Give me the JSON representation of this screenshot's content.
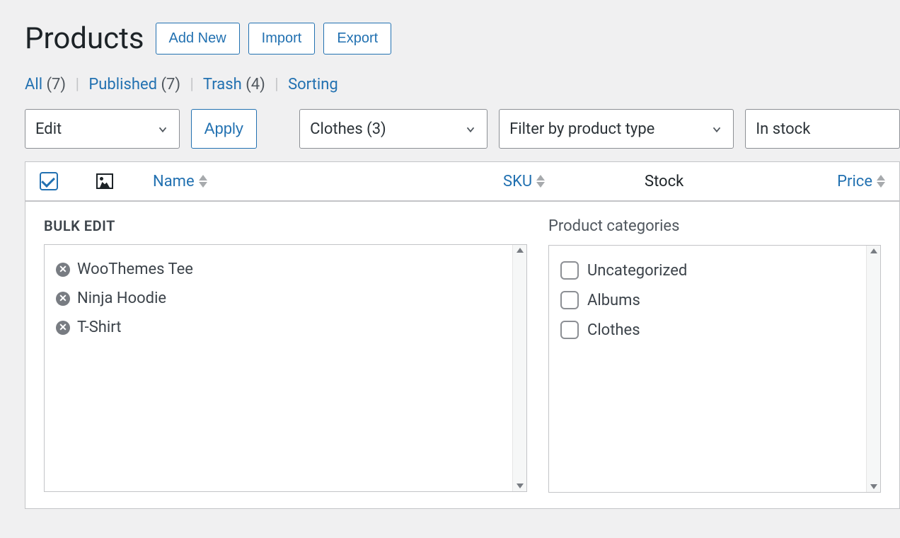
{
  "header": {
    "title": "Products",
    "buttons": {
      "add_new": "Add New",
      "import": "Import",
      "export": "Export"
    }
  },
  "status_links": {
    "all_label": "All",
    "all_count": "(7)",
    "published_label": "Published",
    "published_count": "(7)",
    "trash_label": "Trash",
    "trash_count": "(4)",
    "sorting_label": "Sorting"
  },
  "filters": {
    "bulk_action": "Edit",
    "apply_label": "Apply",
    "category": "Clothes  (3)",
    "type": "Filter by product type",
    "stock": "In stock"
  },
  "columns": {
    "name": "Name",
    "sku": "SKU",
    "stock": "Stock",
    "price": "Price"
  },
  "bulk_edit": {
    "heading": "BULK EDIT",
    "items": [
      "WooThemes Tee",
      "Ninja Hoodie",
      "T-Shirt"
    ]
  },
  "categories_panel": {
    "heading": "Product categories",
    "items": [
      "Uncategorized",
      "Albums",
      "Clothes"
    ]
  }
}
